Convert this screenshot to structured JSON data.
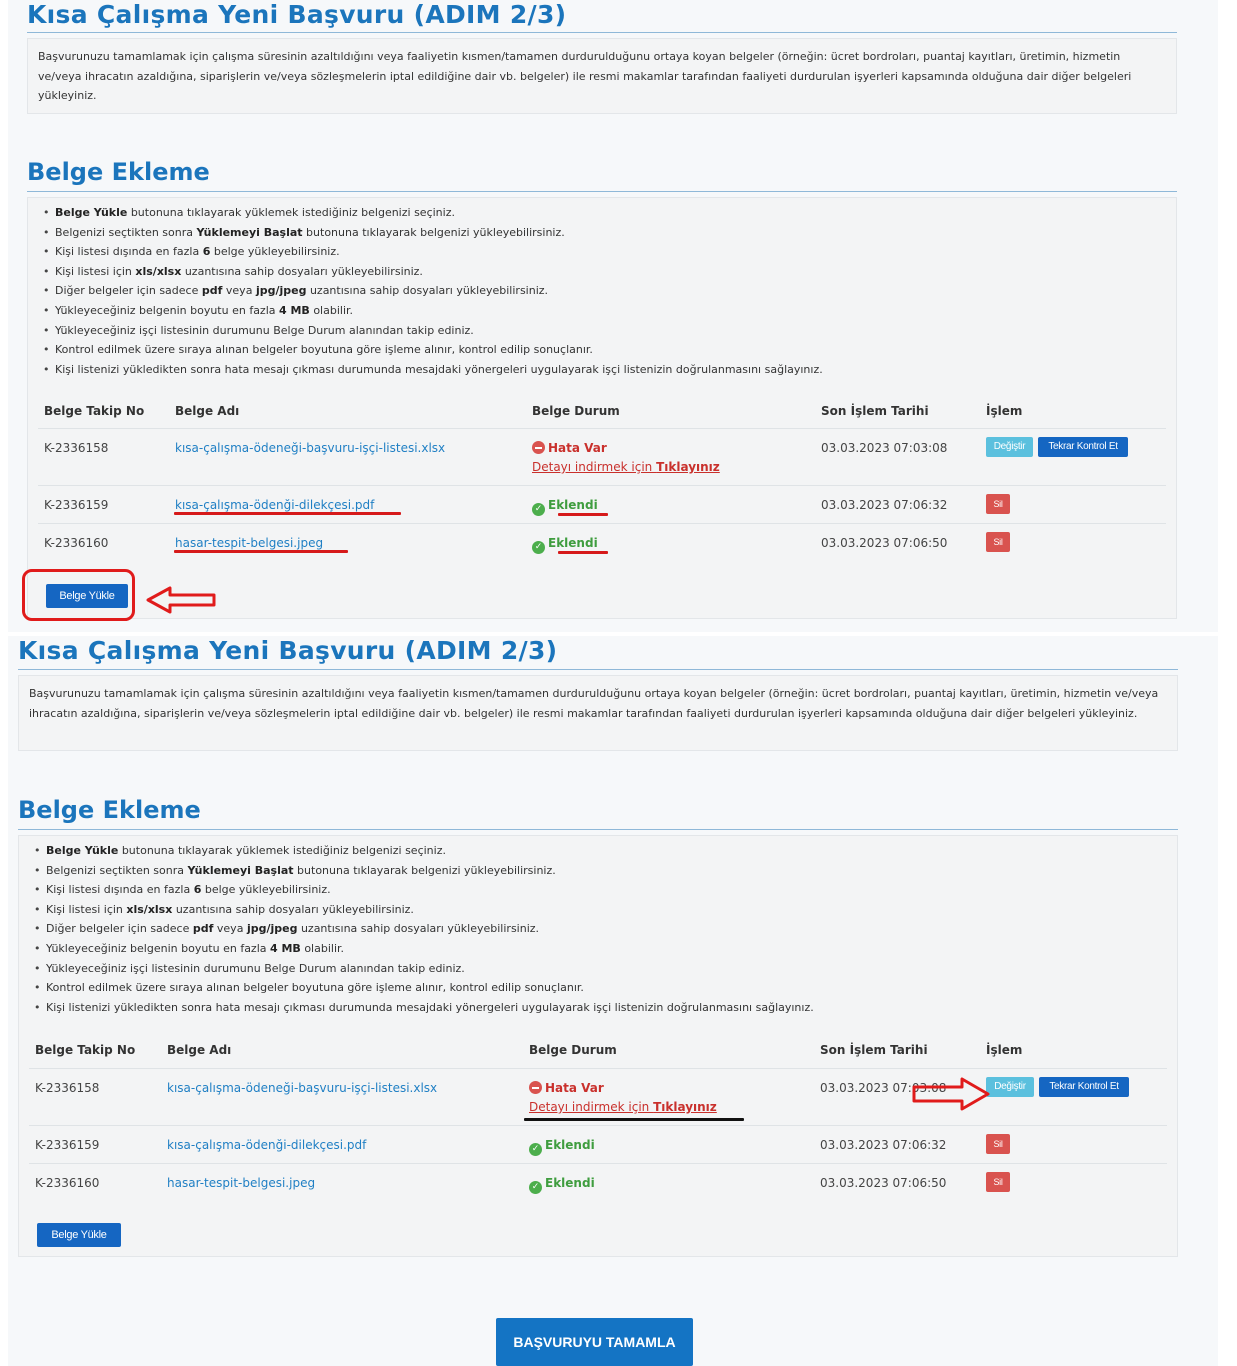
{
  "page_title": "Kısa Çalışma Yeni Başvuru (ADIM 2/3)",
  "intro_text": "Başvurunuzu tamamlamak için çalışma süresinin azaltıldığını veya faaliyetin kısmen/tamamen durdurulduğunu ortaya koyan belgeler (örneğin: ücret bordroları, puantaj kayıtları, üretimin, hizmetin ve/veya ihracatın azaldığına, siparişlerin ve/veya sözleşmelerin iptal edildiğine dair vb. belgeler) ile resmi makamlar tarafından faaliyeti durdurulan işyerleri kapsamında olduğuna dair diğer belgeleri yükleyiniz.",
  "section_title": "Belge Ekleme",
  "rules": [
    {
      "pre": "",
      "b1": "Belge Yükle",
      "mid": " butonuna tıklayarak yüklemek istediğiniz belgenizi seçiniz.",
      "b2": "",
      "post": ""
    },
    {
      "pre": "Belgenizi seçtikten sonra ",
      "b1": "Yüklemeyi Başlat",
      "mid": " butonuna tıklayarak belgenizi yükleyebilirsiniz.",
      "b2": "",
      "post": ""
    },
    {
      "pre": "Kişi listesi dışında en fazla ",
      "b1": "6",
      "mid": " belge yükleyebilirsiniz.",
      "b2": "",
      "post": ""
    },
    {
      "pre": "Kişi listesi için ",
      "b1": "xls/xlsx",
      "mid": " uzantısına sahip dosyaları yükleyebilirsiniz.",
      "b2": "",
      "post": ""
    },
    {
      "pre": "Diğer belgeler için sadece ",
      "b1": "pdf",
      "mid": " veya ",
      "b2": "jpg/jpeg",
      "post": " uzantısına sahip dosyaları yükleyebilirsiniz."
    },
    {
      "pre": "Yükleyeceğiniz belgenin boyutu en fazla ",
      "b1": "4 MB",
      "mid": " olabilir.",
      "b2": "",
      "post": ""
    },
    {
      "pre": "Yükleyeceğiniz işçi listesinin durumunu Belge Durum alanından takip ediniz.",
      "b1": "",
      "mid": "",
      "b2": "",
      "post": ""
    },
    {
      "pre": "Kontrol edilmek üzere sıraya alınan belgeler boyutuna göre işleme alınır, kontrol edilip sonuçlanır.",
      "b1": "",
      "mid": "",
      "b2": "",
      "post": ""
    },
    {
      "pre": "Kişi listenizi yükledikten sonra hata mesajı çıkması durumunda mesajdaki yönergeleri uygulayarak işçi listenizin doğrulanmasını sağlayınız.",
      "b1": "",
      "mid": "",
      "b2": "",
      "post": ""
    }
  ],
  "table": {
    "headers": [
      "Belge Takip No",
      "Belge Adı",
      "Belge Durum",
      "Son İşlem Tarihi",
      "İşlem"
    ],
    "rows": [
      {
        "no": "K-2336158",
        "name": "kısa-çalışma-ödeneği-başvuru-işçi-listesi.xlsx",
        "status": "Hata Var",
        "detail_pre": "Detayı indirmek için ",
        "detail_bold": "Tıklayınız",
        "date": "03.03.2023 07:03:08"
      },
      {
        "no": "K-2336159",
        "name": "kısa-çalışma-ödenği-dilekçesi.pdf",
        "status": "Eklendi",
        "date": "03.03.2023 07:06:32"
      },
      {
        "no": "K-2336160",
        "name": "hasar-tespit-belgesi.jpeg",
        "status": "Eklendi",
        "date": "03.03.2023 07:06:50"
      }
    ]
  },
  "buttons": {
    "change": "Değiştir",
    "recheck": "Tekrar Kontrol Et",
    "delete": "Sil",
    "upload": "Belge Yükle",
    "complete": "BAŞVURUYU TAMAMLA"
  },
  "colors": {
    "title_blue": "#1b75bc",
    "link_blue": "#1f7fc4",
    "error_red": "#c9302c",
    "success_green": "#3f9d3f",
    "button_blue": "#1566c2",
    "change_cyan": "#5bc0de",
    "delete_red": "#d9534f",
    "annotation_red": "#e01b1b"
  }
}
